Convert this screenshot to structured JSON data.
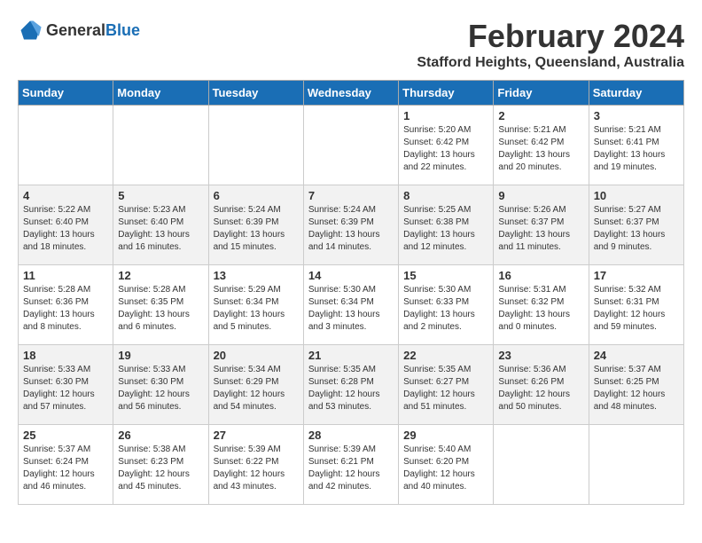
{
  "header": {
    "logo": {
      "general": "General",
      "blue": "Blue"
    },
    "title": "February 2024",
    "location": "Stafford Heights, Queensland, Australia"
  },
  "days_of_week": [
    "Sunday",
    "Monday",
    "Tuesday",
    "Wednesday",
    "Thursday",
    "Friday",
    "Saturday"
  ],
  "weeks": [
    [
      {
        "day": "",
        "info": ""
      },
      {
        "day": "",
        "info": ""
      },
      {
        "day": "",
        "info": ""
      },
      {
        "day": "",
        "info": ""
      },
      {
        "day": "1",
        "info": "Sunrise: 5:20 AM\nSunset: 6:42 PM\nDaylight: 13 hours\nand 22 minutes."
      },
      {
        "day": "2",
        "info": "Sunrise: 5:21 AM\nSunset: 6:42 PM\nDaylight: 13 hours\nand 20 minutes."
      },
      {
        "day": "3",
        "info": "Sunrise: 5:21 AM\nSunset: 6:41 PM\nDaylight: 13 hours\nand 19 minutes."
      }
    ],
    [
      {
        "day": "4",
        "info": "Sunrise: 5:22 AM\nSunset: 6:40 PM\nDaylight: 13 hours\nand 18 minutes."
      },
      {
        "day": "5",
        "info": "Sunrise: 5:23 AM\nSunset: 6:40 PM\nDaylight: 13 hours\nand 16 minutes."
      },
      {
        "day": "6",
        "info": "Sunrise: 5:24 AM\nSunset: 6:39 PM\nDaylight: 13 hours\nand 15 minutes."
      },
      {
        "day": "7",
        "info": "Sunrise: 5:24 AM\nSunset: 6:39 PM\nDaylight: 13 hours\nand 14 minutes."
      },
      {
        "day": "8",
        "info": "Sunrise: 5:25 AM\nSunset: 6:38 PM\nDaylight: 13 hours\nand 12 minutes."
      },
      {
        "day": "9",
        "info": "Sunrise: 5:26 AM\nSunset: 6:37 PM\nDaylight: 13 hours\nand 11 minutes."
      },
      {
        "day": "10",
        "info": "Sunrise: 5:27 AM\nSunset: 6:37 PM\nDaylight: 13 hours\nand 9 minutes."
      }
    ],
    [
      {
        "day": "11",
        "info": "Sunrise: 5:28 AM\nSunset: 6:36 PM\nDaylight: 13 hours\nand 8 minutes."
      },
      {
        "day": "12",
        "info": "Sunrise: 5:28 AM\nSunset: 6:35 PM\nDaylight: 13 hours\nand 6 minutes."
      },
      {
        "day": "13",
        "info": "Sunrise: 5:29 AM\nSunset: 6:34 PM\nDaylight: 13 hours\nand 5 minutes."
      },
      {
        "day": "14",
        "info": "Sunrise: 5:30 AM\nSunset: 6:34 PM\nDaylight: 13 hours\nand 3 minutes."
      },
      {
        "day": "15",
        "info": "Sunrise: 5:30 AM\nSunset: 6:33 PM\nDaylight: 13 hours\nand 2 minutes."
      },
      {
        "day": "16",
        "info": "Sunrise: 5:31 AM\nSunset: 6:32 PM\nDaylight: 13 hours\nand 0 minutes."
      },
      {
        "day": "17",
        "info": "Sunrise: 5:32 AM\nSunset: 6:31 PM\nDaylight: 12 hours\nand 59 minutes."
      }
    ],
    [
      {
        "day": "18",
        "info": "Sunrise: 5:33 AM\nSunset: 6:30 PM\nDaylight: 12 hours\nand 57 minutes."
      },
      {
        "day": "19",
        "info": "Sunrise: 5:33 AM\nSunset: 6:30 PM\nDaylight: 12 hours\nand 56 minutes."
      },
      {
        "day": "20",
        "info": "Sunrise: 5:34 AM\nSunset: 6:29 PM\nDaylight: 12 hours\nand 54 minutes."
      },
      {
        "day": "21",
        "info": "Sunrise: 5:35 AM\nSunset: 6:28 PM\nDaylight: 12 hours\nand 53 minutes."
      },
      {
        "day": "22",
        "info": "Sunrise: 5:35 AM\nSunset: 6:27 PM\nDaylight: 12 hours\nand 51 minutes."
      },
      {
        "day": "23",
        "info": "Sunrise: 5:36 AM\nSunset: 6:26 PM\nDaylight: 12 hours\nand 50 minutes."
      },
      {
        "day": "24",
        "info": "Sunrise: 5:37 AM\nSunset: 6:25 PM\nDaylight: 12 hours\nand 48 minutes."
      }
    ],
    [
      {
        "day": "25",
        "info": "Sunrise: 5:37 AM\nSunset: 6:24 PM\nDaylight: 12 hours\nand 46 minutes."
      },
      {
        "day": "26",
        "info": "Sunrise: 5:38 AM\nSunset: 6:23 PM\nDaylight: 12 hours\nand 45 minutes."
      },
      {
        "day": "27",
        "info": "Sunrise: 5:39 AM\nSunset: 6:22 PM\nDaylight: 12 hours\nand 43 minutes."
      },
      {
        "day": "28",
        "info": "Sunrise: 5:39 AM\nSunset: 6:21 PM\nDaylight: 12 hours\nand 42 minutes."
      },
      {
        "day": "29",
        "info": "Sunrise: 5:40 AM\nSunset: 6:20 PM\nDaylight: 12 hours\nand 40 minutes."
      },
      {
        "day": "",
        "info": ""
      },
      {
        "day": "",
        "info": ""
      }
    ]
  ]
}
